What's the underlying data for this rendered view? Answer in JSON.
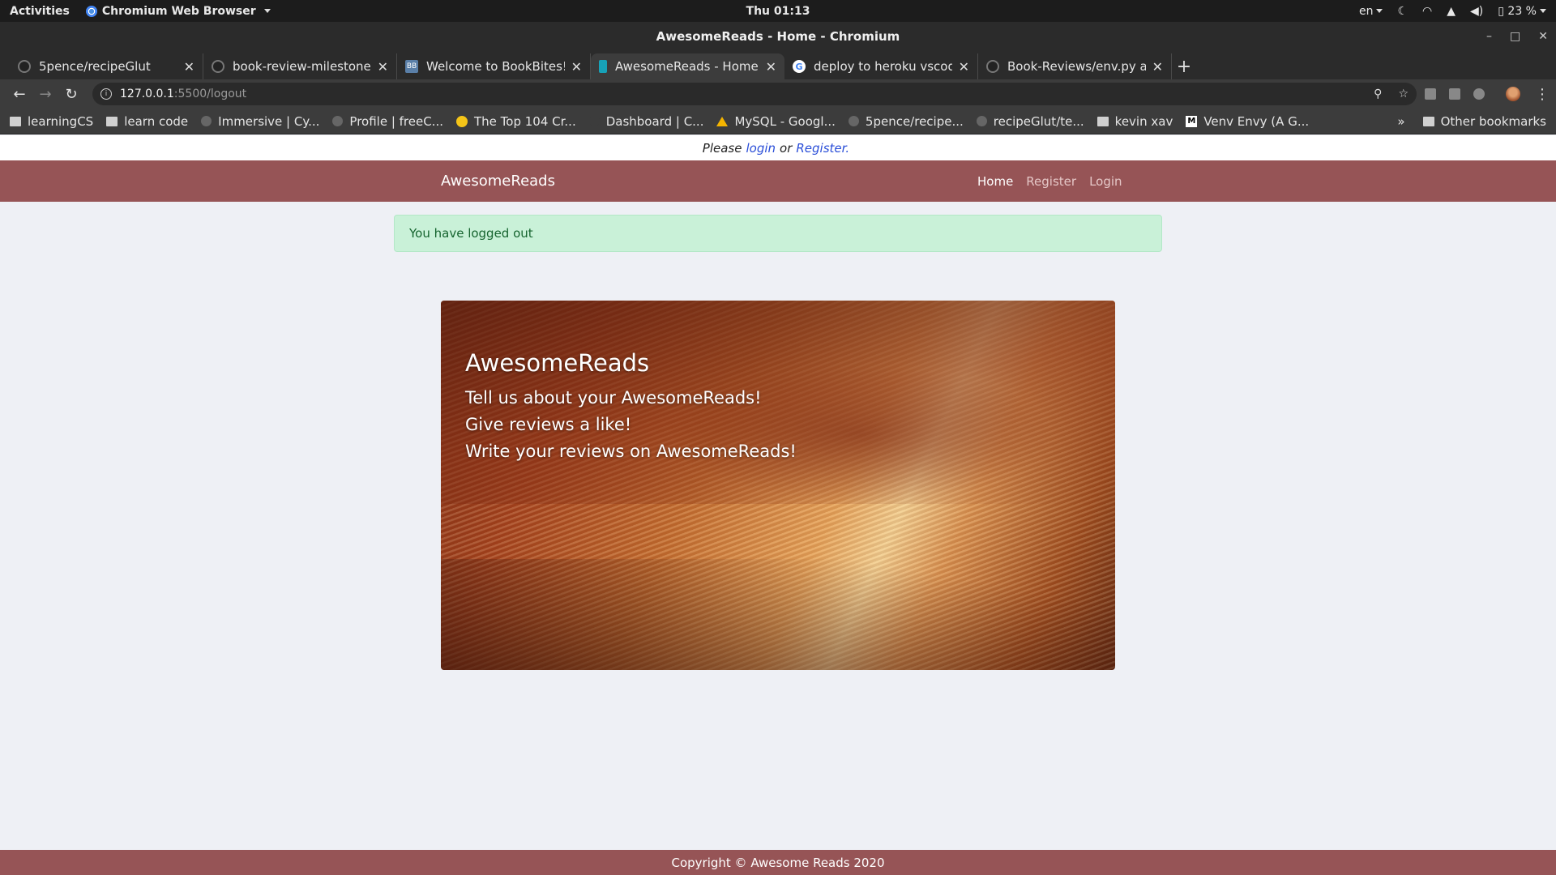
{
  "system_bar": {
    "activities": "Activities",
    "app_name": "Chromium Web Browser",
    "clock": "Thu 01:13",
    "keyboard_layout": "en",
    "battery": "23 %"
  },
  "window": {
    "title": "AwesomeReads - Home - Chromium"
  },
  "tabs": [
    {
      "title": "5pence/recipeGlut",
      "icon": "github-icon"
    },
    {
      "title": "book-review-milestone-pr",
      "icon": "github-icon"
    },
    {
      "title": "Welcome to BookBites!",
      "icon": "bookbites-icon"
    },
    {
      "title": "AwesomeReads - Home",
      "icon": "awesomereads-icon",
      "active": true
    },
    {
      "title": "deploy to heroku vscode -",
      "icon": "google-icon"
    },
    {
      "title": "Book-Reviews/env.py at m",
      "icon": "github-icon"
    }
  ],
  "address_bar": {
    "host": "127.0.0.1",
    "path": ":5500/logout"
  },
  "bookmarks": [
    {
      "label": "learningCS",
      "icon": "folder-icon"
    },
    {
      "label": "learn code",
      "icon": "folder-icon"
    },
    {
      "label": "Immersive | Cy...",
      "icon": "immersive-icon"
    },
    {
      "label": "Profile | freeC...",
      "icon": "freecodecamp-icon"
    },
    {
      "label": "The Top 104 Cr...",
      "icon": "emoji-icon"
    },
    {
      "label": "Dashboard | C...",
      "icon": "dashboard-icon"
    },
    {
      "label": "MySQL - Googl...",
      "icon": "google-drive-icon"
    },
    {
      "label": "5pence/recipe...",
      "icon": "github-icon"
    },
    {
      "label": "recipeGlut/te...",
      "icon": "github-icon"
    },
    {
      "label": "kevin xav",
      "icon": "folder-icon"
    },
    {
      "label": "Venv Envy (A G...",
      "icon": "medium-icon"
    }
  ],
  "bookmarks_overflow": "»",
  "other_bookmarks": "Other bookmarks",
  "page": {
    "please_text_1": "Please",
    "login_link": "login",
    "please_text_2": "or",
    "register_link": "Register.",
    "brand": "AwesomeReads",
    "nav": {
      "home": "Home",
      "register": "Register",
      "login": "Login"
    },
    "flash_message": "You have logged out",
    "hero": {
      "title": "AwesomeReads",
      "line1": "Tell us about your AwesomeReads!",
      "line2": "Give reviews a like!",
      "line3": "Write your reviews on AwesomeReads!"
    },
    "footer": "Copyright © Awesome Reads 2020"
  },
  "colors": {
    "navbar": "#965456",
    "flash_bg": "#c9f1d8",
    "flash_text": "#16642f",
    "page_bg": "#eef0f5",
    "link": "#2a4ed8"
  }
}
